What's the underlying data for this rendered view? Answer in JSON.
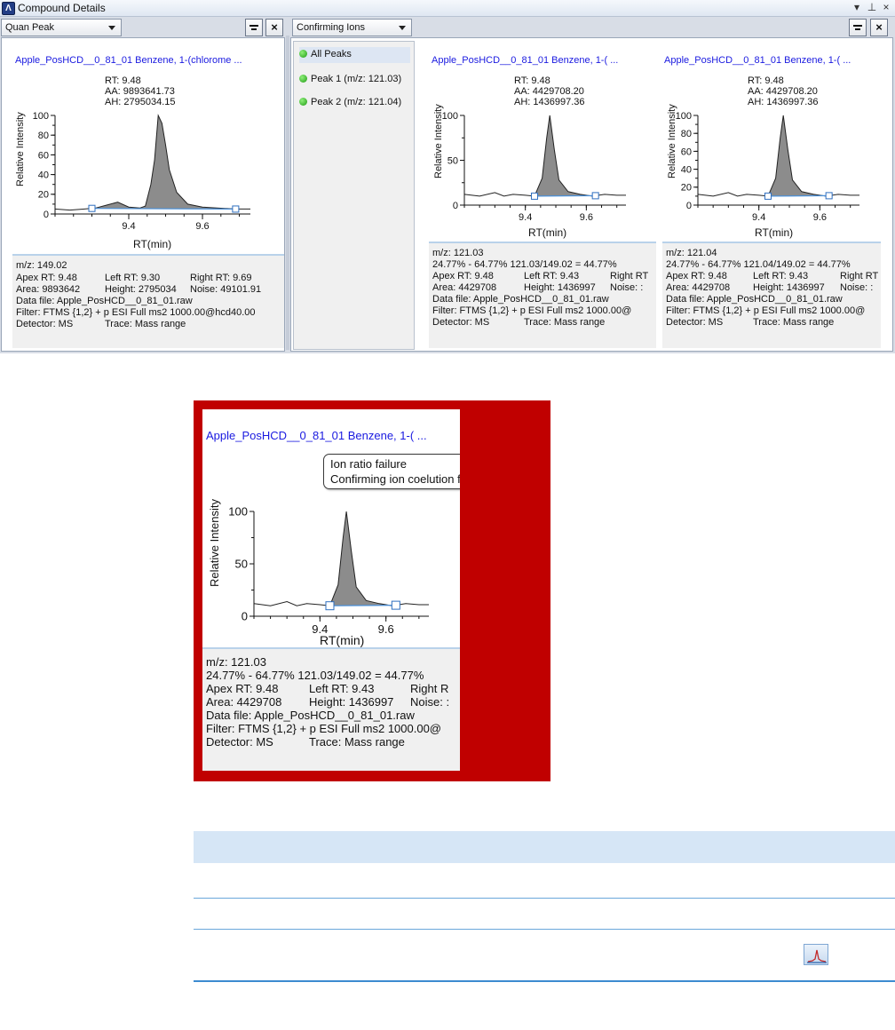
{
  "window": {
    "title": "Compound Details",
    "title_controls": [
      "▾",
      "⊥",
      "×"
    ],
    "app_icon": "thermo-app-icon"
  },
  "left_panel": {
    "dropdown": "Quan Peak",
    "close_label": "×"
  },
  "right_panel": {
    "dropdown": "Confirming Ions",
    "close_label": "×"
  },
  "peak_list": [
    {
      "label": "All Peaks",
      "status_color": "#2fb51f"
    },
    {
      "label": "Peak 1 (m/z: 121.03)",
      "status_color": "#2fb51f"
    },
    {
      "label": "Peak 2 (m/z: 121.04)",
      "status_color": "#2fb51f"
    }
  ],
  "quan_card": {
    "title": "Apple_PosHCD__0_81_01   Benzene, 1-(chlorome ...",
    "stats": [
      "RT: 9.48",
      "AA: 9893641.73",
      "AH: 2795034.15"
    ],
    "ylabel": "Relative Intensity",
    "xlabel": "RT(min)",
    "info": {
      "mz": "m/z: 149.02",
      "row2": [
        "Apex RT:  9.48",
        "Left RT:  9.30",
        "Right RT:  9.69"
      ],
      "row3": [
        "Area:  9893642",
        "Height:  2795034",
        "Noise:  49101.91"
      ],
      "datafile": "Data file:  Apple_PosHCD__0_81_01.raw",
      "filter": "Filter:  FTMS {1,2}  + p ESI Full ms2 1000.00@hcd40.00",
      "row6": [
        "Detector:  MS",
        "Trace:  Mass range"
      ]
    }
  },
  "ion_card_1": {
    "title": "Apple_PosHCD__0_81_01   Benzene, 1-( ...",
    "stats": [
      "RT: 9.48",
      "AA: 4429708.20",
      "AH: 1436997.36"
    ],
    "ylabel": "Relative Intensity",
    "xlabel": "RT(min)",
    "info": {
      "mz": "m/z: 121.03",
      "ratio": "24.77% - 64.77% 121.03/149.02 = 44.77%",
      "row2": [
        "Apex RT:  9.48",
        "Left RT:  9.43",
        "Right RT"
      ],
      "row3": [
        "Area:  4429708",
        "Height:  1436997",
        "Noise:  :"
      ],
      "datafile": "Data file:  Apple_PosHCD__0_81_01.raw",
      "filter": "Filter:  FTMS {1,2}  + p ESI Full ms2 1000.00@",
      "row6": [
        "Detector:  MS",
        "Trace:  Mass range"
      ]
    }
  },
  "ion_card_2": {
    "title": "Apple_PosHCD__0_81_01   Benzene, 1-( ...",
    "stats": [
      "RT: 9.48",
      "AA: 4429708.20",
      "AH: 1436997.36"
    ],
    "ylabel": "Relative Intensity",
    "xlabel": "RT(min)",
    "info": {
      "mz": "m/z: 121.04",
      "ratio": "24.77% - 64.77% 121.04/149.02 = 44.77%",
      "row2": [
        "Apex RT:  9.48",
        "Left RT:  9.43",
        "Right RT"
      ],
      "row3": [
        "Area:  4429708",
        "Height:  1436997",
        "Noise:  :"
      ],
      "datafile": "Data file:  Apple_PosHCD__0_81_01.raw",
      "filter": "Filter:  FTMS {1,2}  + p ESI Full ms2 1000.00@",
      "row6": [
        "Detector:  MS",
        "Trace:  Mass range"
      ]
    }
  },
  "zoom_card": {
    "title": "Apple_PosHCD__0_81_01   Benzene, 1-( ...",
    "callout": [
      "Ion ratio failure",
      "Confirming ion coelution failure"
    ],
    "ylabel": "Relative Intensity",
    "xlabel": "RT(min)",
    "info": {
      "mz": "m/z: 121.03",
      "ratio": "24.77% - 64.77% 121.03/149.02 = 44.77%",
      "row2": [
        "Apex RT:  9.48",
        "Left RT:  9.43",
        "Right R"
      ],
      "row3": [
        "Area:  4429708",
        "Height:  1436997",
        "Noise:  :"
      ],
      "datafile": "Data file:  Apple_PosHCD__0_81_01.raw",
      "filter": "Filter:  FTMS {1,2}  + p ESI Full ms2 1000.00@",
      "row6": [
        "Detector:  MS",
        "Trace:  Mass range"
      ]
    }
  },
  "colors": {
    "highlight_frame": "#c00000",
    "peak_fill": "#8c8c8c",
    "baseline": "#4a90d9",
    "title_link": "#1a1ae0"
  },
  "table_icon": "peak-chart-icon",
  "chart_data": [
    {
      "type": "area",
      "name": "quan-peak",
      "x": [
        9.2,
        9.24,
        9.28,
        9.31,
        9.34,
        9.37,
        9.4,
        9.43,
        9.445,
        9.46,
        9.47,
        9.48,
        9.49,
        9.5,
        9.51,
        9.53,
        9.56,
        9.6,
        9.64,
        9.69,
        9.73
      ],
      "y": [
        5,
        4,
        5,
        6,
        9,
        12,
        7,
        6,
        8,
        30,
        55,
        100,
        92,
        70,
        45,
        22,
        10,
        7,
        6,
        5,
        5
      ],
      "peak_boundaries": [
        9.3,
        9.69
      ],
      "xticks": [
        9.4,
        9.6
      ],
      "yticks": [
        0,
        20,
        40,
        60,
        80,
        100
      ],
      "xlim": [
        9.2,
        9.73
      ],
      "ylim": [
        0,
        100
      ]
    },
    {
      "type": "area",
      "name": "confirming-ion-1",
      "x": [
        9.2,
        9.25,
        9.3,
        9.33,
        9.36,
        9.4,
        9.43,
        9.455,
        9.47,
        9.48,
        9.495,
        9.51,
        9.54,
        9.58,
        9.62,
        9.66,
        9.7,
        9.73
      ],
      "y": [
        12,
        10,
        14,
        10,
        12,
        11,
        10,
        30,
        75,
        100,
        62,
        28,
        15,
        12,
        10,
        12,
        11,
        11
      ],
      "peak_boundaries": [
        9.43,
        9.63
      ],
      "xticks": [
        9.4,
        9.6
      ],
      "yticks": [
        0,
        50,
        100
      ],
      "xlim": [
        9.2,
        9.73
      ],
      "ylim": [
        0,
        100
      ]
    },
    {
      "type": "area",
      "name": "confirming-ion-2",
      "x": [
        9.2,
        9.25,
        9.3,
        9.33,
        9.36,
        9.4,
        9.43,
        9.455,
        9.47,
        9.48,
        9.495,
        9.51,
        9.54,
        9.58,
        9.62,
        9.66,
        9.7,
        9.73
      ],
      "y": [
        12,
        10,
        14,
        10,
        12,
        11,
        10,
        30,
        75,
        100,
        62,
        28,
        15,
        12,
        10,
        12,
        11,
        11
      ],
      "peak_boundaries": [
        9.43,
        9.63
      ],
      "xticks": [
        9.4,
        9.6
      ],
      "yticks": [
        0,
        20,
        40,
        60,
        80,
        100
      ],
      "xlim": [
        9.2,
        9.73
      ],
      "ylim": [
        0,
        100
      ]
    }
  ]
}
